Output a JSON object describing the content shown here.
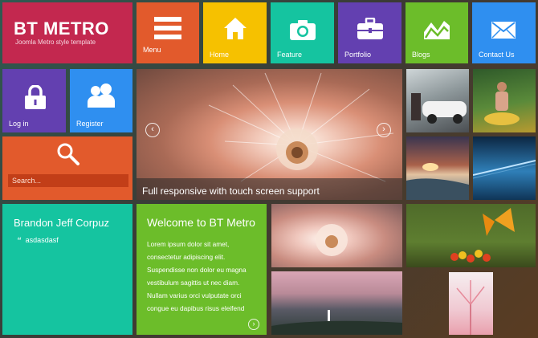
{
  "brand": {
    "title": "BT METRO",
    "subtitle": "Joomla Metro style template"
  },
  "nav": {
    "menu": "Menu",
    "home": "Home",
    "feature": "Feature",
    "portfolio": "Portfolio",
    "blogs": "Blogs",
    "contact": "Contact Us"
  },
  "account": {
    "login": "Log in",
    "register": "Register"
  },
  "search": {
    "placeholder": "Search..."
  },
  "slider": {
    "caption": "Full responsive with touch screen support",
    "prev": "‹",
    "next": "›"
  },
  "author": {
    "name": "Brandon Jeff Corpuz",
    "quote_mark": "“",
    "quote": "asdasdasf"
  },
  "welcome": {
    "title": "Welcome to BT Metro",
    "body": "Lorem ipsum dolor sit amet, consectetur adipiscing elit. Suspendisse non dolor eu magna vestibulum sagittis ut nec diam. Nullam varius orci vulputate orci congue eu dapibus risus eleifend",
    "more": "›"
  },
  "colors": {
    "crimson": "#c3284f",
    "orange": "#e25a2c",
    "yellow": "#f6c100",
    "teal": "#15c4a0",
    "purple": "#6340b0",
    "green": "#6cbd2a",
    "blue": "#2f8ff0"
  },
  "icons": {
    "menu": "hamburger-icon",
    "home": "house-icon",
    "feature": "camera-icon",
    "portfolio": "briefcase-icon",
    "blogs": "chart-icon",
    "contact": "envelope-icon",
    "login": "lock-icon",
    "register": "users-icon",
    "search": "magnifier-icon"
  }
}
